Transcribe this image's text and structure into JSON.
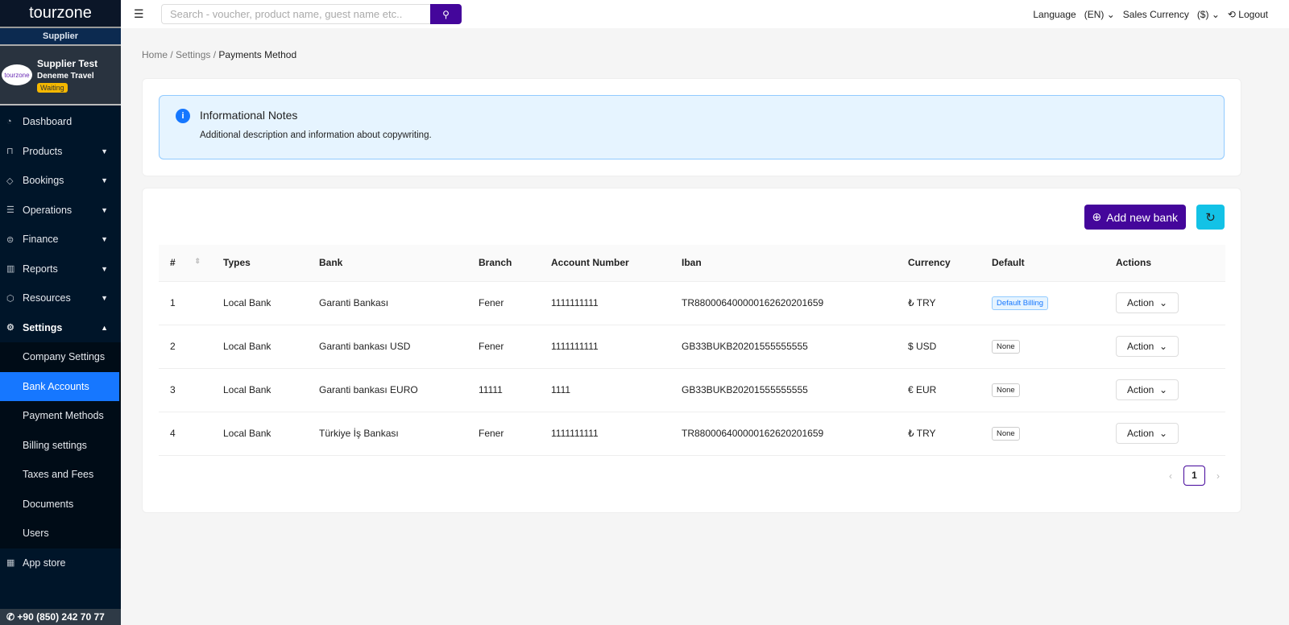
{
  "brand": "tourzone",
  "sidebar": {
    "role": "Supplier",
    "profile": {
      "name": "Supplier Test",
      "company": "Deneme Travel",
      "status": "Waiting"
    },
    "items": [
      {
        "label": "Dashboard",
        "icon": "dashboard-icon"
      },
      {
        "label": "Products",
        "icon": "bag-icon"
      },
      {
        "label": "Bookings",
        "icon": "ticket-icon"
      },
      {
        "label": "Operations",
        "icon": "list-icon"
      },
      {
        "label": "Finance",
        "icon": "coin-icon"
      },
      {
        "label": "Reports",
        "icon": "chart-icon"
      },
      {
        "label": "Resources",
        "icon": "box-icon"
      },
      {
        "label": "Settings",
        "icon": "gear-icon"
      }
    ],
    "settings_sub": [
      "Company Settings",
      "Bank Accounts",
      "Payment Methods",
      "Billing settings",
      "Taxes and Fees",
      "Documents",
      "Users"
    ],
    "app_store": "App store",
    "phone": "+90 (850) 242 70 77"
  },
  "header": {
    "search_placeholder": "Search - voucher, product name, guest name etc..",
    "language_label": "Language",
    "language_value": "(EN)",
    "currency_label": "Sales Currency",
    "currency_value": "($)",
    "logout": "Logout"
  },
  "breadcrumb": [
    "Home",
    "Settings",
    "Payments Method"
  ],
  "note": {
    "title": "Informational Notes",
    "desc": "Additional description and information about copywriting."
  },
  "actions": {
    "add": "Add new bank"
  },
  "table": {
    "headers": [
      "#",
      "Types",
      "Bank",
      "Branch",
      "Account Number",
      "Iban",
      "Currency",
      "Default",
      "Actions"
    ],
    "rows": [
      {
        "n": "1",
        "type": "Local Bank",
        "bank": "Garanti Bankası",
        "branch": "Fener",
        "acc": "1111111111",
        "iban": "TR880006400000162620201659",
        "cur": "₺ TRY",
        "def": "Default Billing",
        "action": "Action"
      },
      {
        "n": "2",
        "type": "Local Bank",
        "bank": "Garanti bankası USD",
        "branch": "Fener",
        "acc": "1111111111",
        "iban": "GB33BUKB20201555555555",
        "cur": "$ USD",
        "def": "None",
        "action": "Action"
      },
      {
        "n": "3",
        "type": "Local Bank",
        "bank": "Garanti bankası EURO",
        "branch": "11111",
        "acc": "1111",
        "iban": "GB33BUKB20201555555555",
        "cur": "€ EUR",
        "def": "None",
        "action": "Action"
      },
      {
        "n": "4",
        "type": "Local Bank",
        "bank": "Türkiye İş Bankası",
        "branch": "Fener",
        "acc": "1111111111",
        "iban": "TR880006400000162620201659",
        "cur": "₺ TRY",
        "def": "None",
        "action": "Action"
      }
    ]
  },
  "pagination": {
    "current": "1"
  }
}
